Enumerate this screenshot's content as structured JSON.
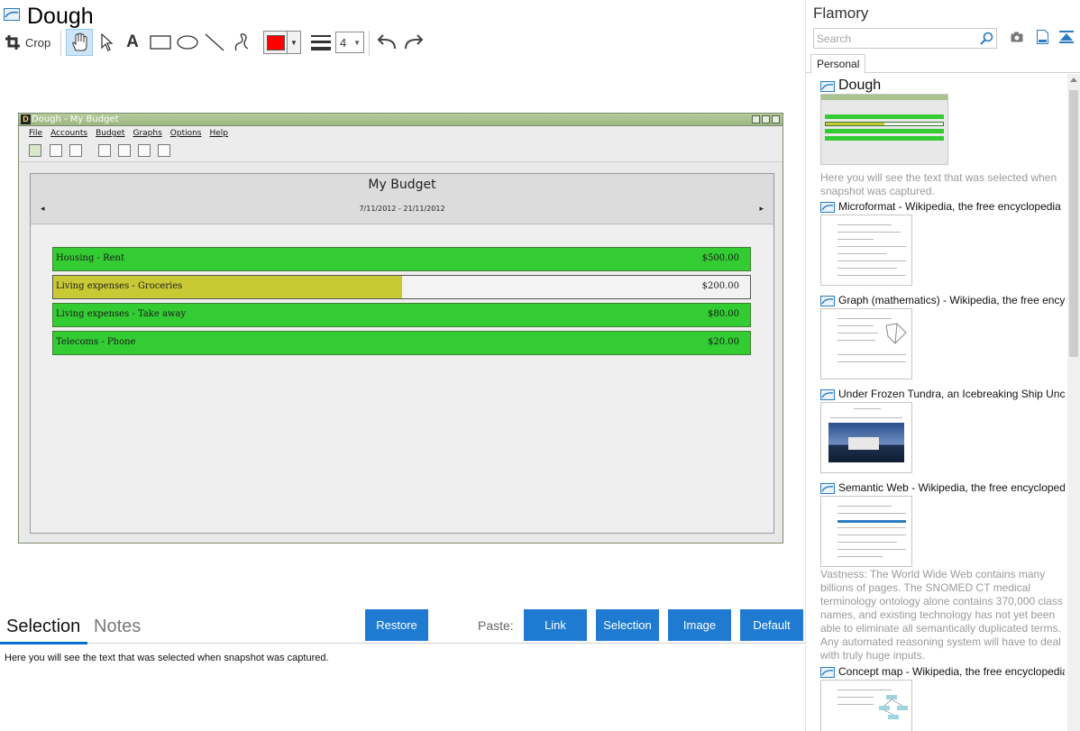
{
  "document": {
    "title": "Dough"
  },
  "toolbar": {
    "crop_label": "Crop",
    "pen_color": "#ff0000",
    "line_width": "4"
  },
  "snapshot": {
    "window_title": "Dough - My Budget",
    "menu": [
      "File",
      "Accounts",
      "Budget",
      "Graphs",
      "Options",
      "Help"
    ],
    "budget_title": "My Budget",
    "date_range": "7/11/2012 - 21/11/2012",
    "rows": [
      {
        "label": "Housing - Rent",
        "amount": "$500.00",
        "progress": 1.0,
        "color": "#33cc33"
      },
      {
        "label": "Living expenses - Groceries",
        "amount": "$200.00",
        "progress": 0.5,
        "color": "#c9c936"
      },
      {
        "label": "Living expenses - Take away",
        "amount": "$80.00",
        "progress": 1.0,
        "color": "#33cc33"
      },
      {
        "label": "Telecoms - Phone",
        "amount": "$20.00",
        "progress": 1.0,
        "color": "#33cc33"
      }
    ]
  },
  "bottom": {
    "tab_selection": "Selection",
    "tab_notes": "Notes",
    "restore_label": "Restore",
    "paste_label": "Paste:",
    "paste_buttons": [
      "Link",
      "Selection",
      "Image",
      "Default"
    ],
    "selection_text": "Here you will see the text that was selected when snapshot was captured."
  },
  "sidebar": {
    "app_name": "Flamory",
    "search_placeholder": "Search",
    "tab_personal": "Personal",
    "items": [
      {
        "title": "Dough",
        "desc": "Here you will see the text that was selected when snapshot was captured."
      },
      {
        "title": "Microformat - Wikipedia, the free encyclopedia",
        "desc": ""
      },
      {
        "title": "Graph (mathematics) - Wikipedia, the free encyclopedia",
        "desc": ""
      },
      {
        "title": "Under Frozen Tundra, an Icebreaking Ship Uncovers",
        "desc": ""
      },
      {
        "title": "Semantic Web - Wikipedia, the free encyclopedia",
        "desc": "Vastness: The World Wide Web contains many billions of pages. The SNOMED CT medical terminology ontology alone contains 370,000 class names, and existing technology has not yet been able to eliminate all semantically duplicated terms. Any automated reasoning system will have to deal with truly huge inputs."
      },
      {
        "title": "Concept map - Wikipedia, the free encyclopedia",
        "desc": ""
      }
    ]
  },
  "accent_color": "#1e7bd1"
}
